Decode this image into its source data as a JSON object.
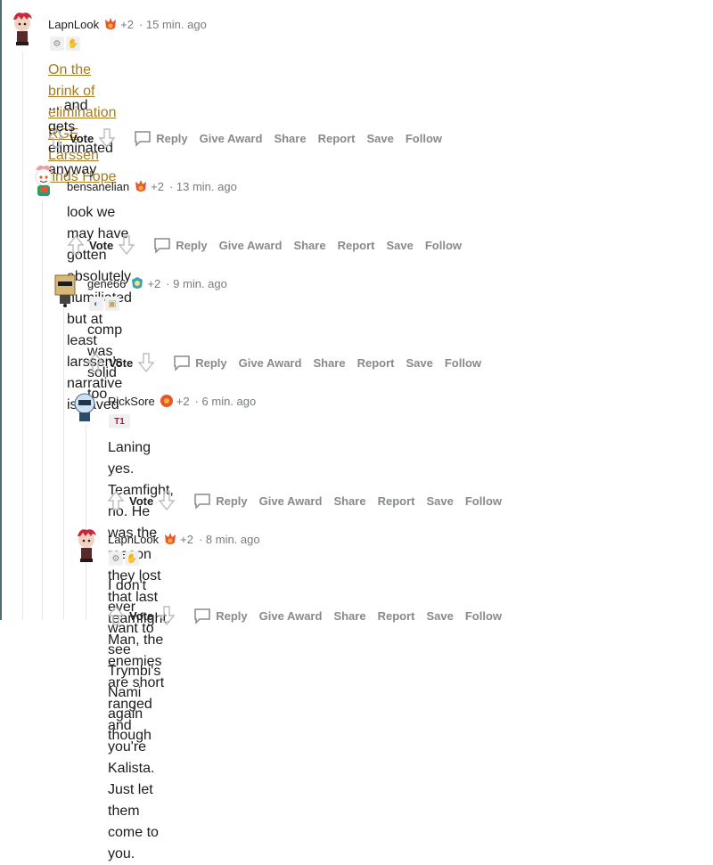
{
  "actions": {
    "vote": "Vote",
    "reply": "Reply",
    "give_award": "Give Award",
    "share": "Share",
    "report": "Report",
    "save": "Save",
    "follow": "Follow"
  },
  "comments": [
    {
      "author": "LapnLook",
      "extra": "+2",
      "time": "· 15 min. ago",
      "link_text": "On the brink of elimination RGE Larssen finds Hope",
      "text": "... and gets eliminated anyway"
    },
    {
      "author": "bensanelian",
      "extra": "+2",
      "time": "· 13 min. ago",
      "text": "look we may have gotten absolutely humiliated but at least larssen's narrative is saved"
    },
    {
      "author": "gene66",
      "extra": "+2",
      "time": "· 9 min. ago",
      "text": "comp was solid too"
    },
    {
      "author": "RickSore",
      "extra": "+2",
      "time": "· 6 min. ago",
      "text_line1": "Laning yes. Teamfight, no. He was the reason they lost that last teamfight. Man, the",
      "text_line2": "enemies are short ranged and you're Kalista. Just let them come to you."
    },
    {
      "author": "LapnLook",
      "extra": "+2",
      "time": "· 8 min. ago",
      "text": "I don't ever want to see Trymbi's Nami again though"
    }
  ],
  "colors": {
    "link": "#a57c22",
    "meta": "#787c7e",
    "action": "#878a8c",
    "flair_orange": "#e8562a"
  }
}
